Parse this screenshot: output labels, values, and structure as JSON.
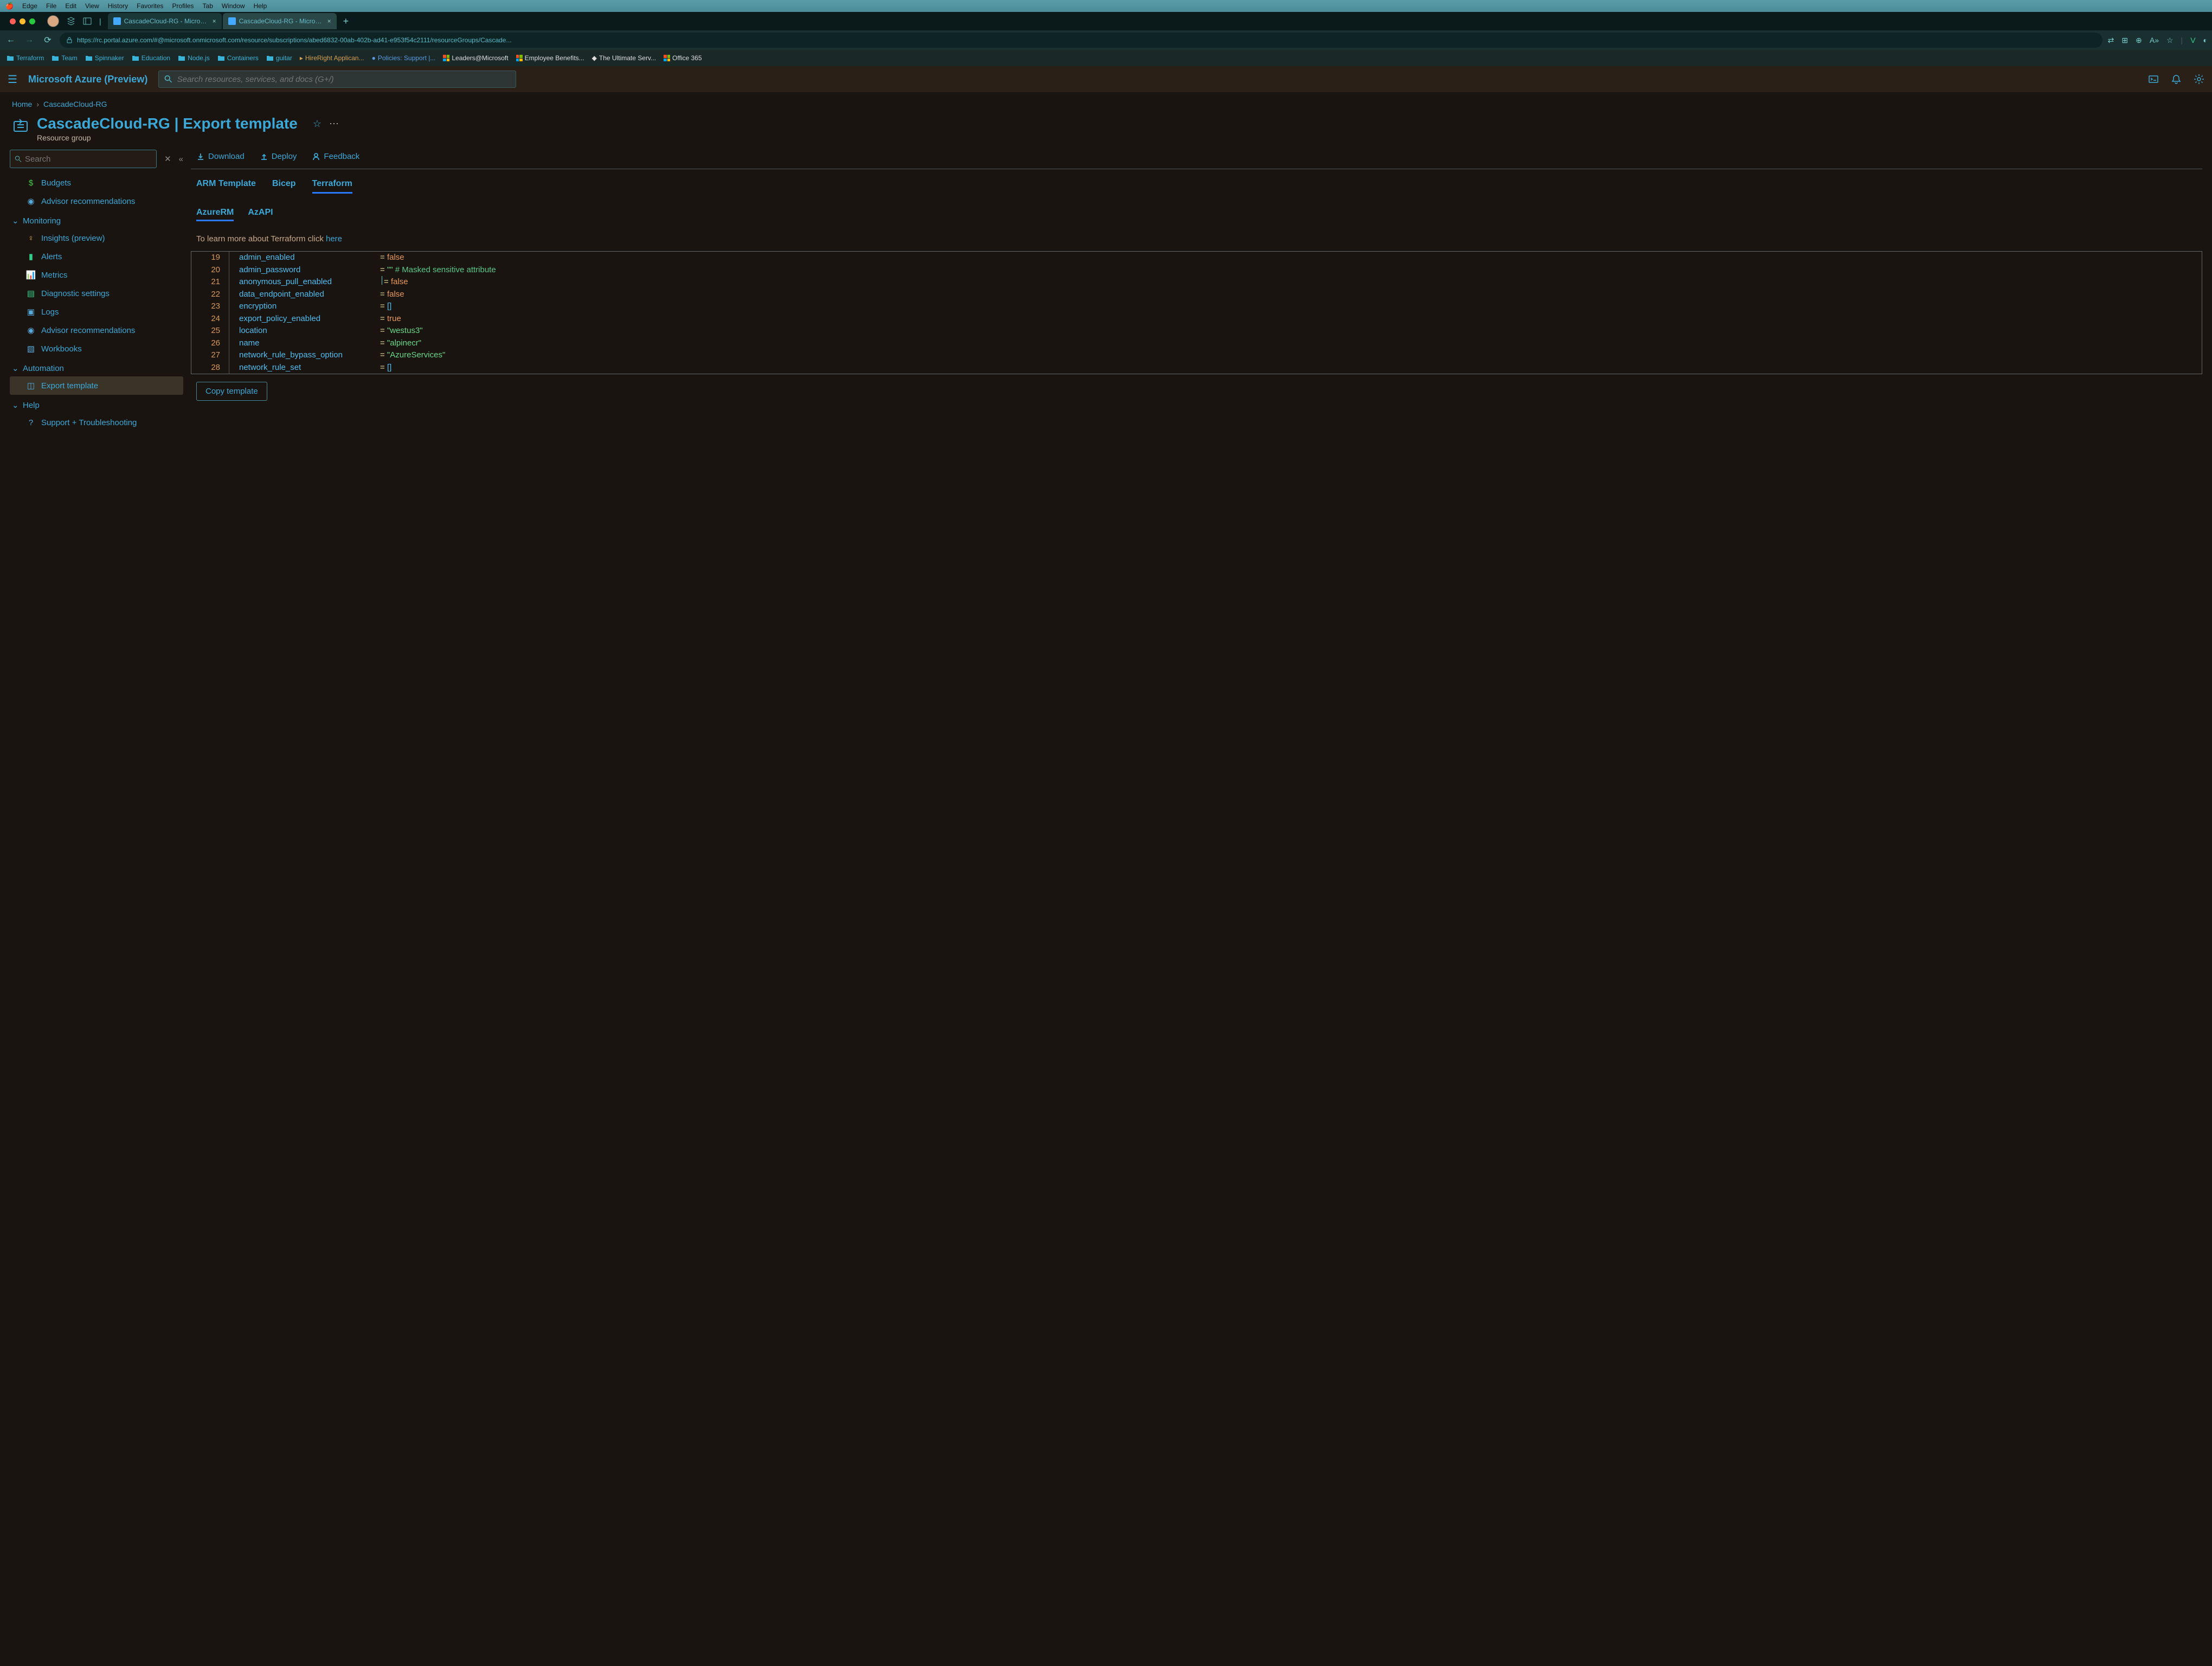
{
  "mac_menu": [
    "Edge",
    "File",
    "Edit",
    "View",
    "History",
    "Favorites",
    "Profiles",
    "Tab",
    "Window",
    "Help"
  ],
  "browser": {
    "tabs": [
      {
        "title": "CascadeCloud-RG - Microsoft A"
      },
      {
        "title": "CascadeCloud-RG - Microsoft A"
      }
    ],
    "url": "https://rc.portal.azure.com/#@microsoft.onmicrosoft.com/resource/subscriptions/abed6832-00ab-402b-ad41-e953f54c2111/resourceGroups/Cascade...",
    "bookmarks": [
      "Terraform",
      "Team",
      "Spinnaker",
      "Education",
      "Node.js",
      "Containers",
      "guitar",
      "HireRight Applican...",
      "Policies: Support |...",
      "Leaders@Microsoft",
      "Employee Benefits...",
      "The Ultimate Serv...",
      "Office 365"
    ]
  },
  "portal": {
    "title": "Microsoft Azure (Preview)",
    "search_placeholder": "Search resources, services, and docs (G+/)"
  },
  "breadcrumb": {
    "home": "Home",
    "current": "CascadeCloud-RG"
  },
  "blade": {
    "title": "CascadeCloud-RG | Export template",
    "subtitle": "Resource group"
  },
  "sidebar": {
    "search_placeholder": "Search",
    "items_top": [
      {
        "icon": "dollar",
        "label": "Budgets"
      },
      {
        "icon": "bulb",
        "label": "Advisor recommendations"
      }
    ],
    "section_monitoring": "Monitoring",
    "items_mon": [
      {
        "icon": "insights",
        "label": "Insights (preview)"
      },
      {
        "icon": "alerts",
        "label": "Alerts"
      },
      {
        "icon": "metrics",
        "label": "Metrics"
      },
      {
        "icon": "diag",
        "label": "Diagnostic settings"
      },
      {
        "icon": "logs",
        "label": "Logs"
      },
      {
        "icon": "bulb",
        "label": "Advisor recommendations"
      },
      {
        "icon": "workbook",
        "label": "Workbooks"
      }
    ],
    "section_automation": "Automation",
    "items_auto": [
      {
        "icon": "export",
        "label": "Export template",
        "selected": true
      }
    ],
    "section_help": "Help",
    "items_help": [
      {
        "icon": "help",
        "label": "Support + Troubleshooting"
      }
    ]
  },
  "toolbar": {
    "download": "Download",
    "deploy": "Deploy",
    "feedback": "Feedback"
  },
  "tabs": {
    "arm": "ARM Template",
    "bicep": "Bicep",
    "terraform": "Terraform"
  },
  "subtabs": {
    "azurerm": "AzureRM",
    "azapi": "AzAPI"
  },
  "hint": {
    "text": "To learn more about Terraform click ",
    "link": "here"
  },
  "code": [
    {
      "ln": "19",
      "key": "admin_enabled",
      "val": "false",
      "t": "bool"
    },
    {
      "ln": "20",
      "key": "admin_password",
      "val": "\"\"",
      "t": "str",
      "cmt": " # Masked sensitive attribute"
    },
    {
      "ln": "21",
      "key": "anonymous_pull_enabled",
      "val": "false",
      "t": "bool",
      "cursor": true
    },
    {
      "ln": "22",
      "key": "data_endpoint_enabled",
      "val": "false",
      "t": "bool"
    },
    {
      "ln": "23",
      "key": "encryption",
      "val": "[]",
      "t": "list"
    },
    {
      "ln": "24",
      "key": "export_policy_enabled",
      "val": "true",
      "t": "bool"
    },
    {
      "ln": "25",
      "key": "location",
      "val": "\"westus3\"",
      "t": "str"
    },
    {
      "ln": "26",
      "key": "name",
      "val": "\"alpinecr\"",
      "t": "str"
    },
    {
      "ln": "27",
      "key": "network_rule_bypass_option",
      "val": "\"AzureServices\"",
      "t": "str"
    },
    {
      "ln": "28",
      "key": "network_rule_set",
      "val": "[]",
      "t": "list"
    }
  ],
  "copy_btn": "Copy template"
}
